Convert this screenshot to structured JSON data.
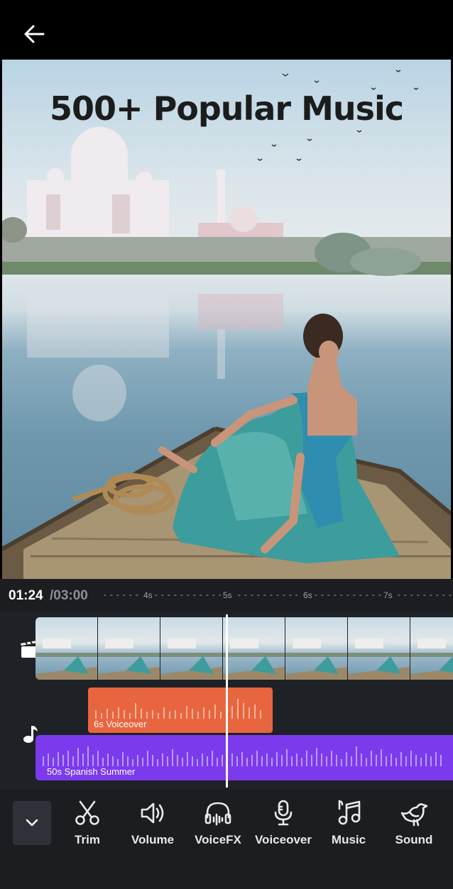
{
  "header": {
    "back_icon": "arrow-left-icon"
  },
  "preview": {
    "headline": "500+ Popular Music"
  },
  "timeline": {
    "current_time": "01:24",
    "total_time": "/03:00",
    "ruler_labels": [
      "4s",
      "5s",
      "6s",
      "7s"
    ]
  },
  "tracks": {
    "video_icon": "clapperboard-icon",
    "audio_icon": "music-note-icon",
    "voiceover_clip": {
      "label": "6s Voiceover",
      "color": "#e8663f"
    },
    "music_clip": {
      "label": "50s Spanish Summer",
      "color": "#7c3aed"
    }
  },
  "toolbar": {
    "collapse_icon": "chevron-down-icon",
    "tools": [
      {
        "label": "Trim",
        "icon": "scissors-icon"
      },
      {
        "label": "Volume",
        "icon": "speaker-icon"
      },
      {
        "label": "VoiceFX",
        "icon": "headphones-icon"
      },
      {
        "label": "Voiceover",
        "icon": "microphone-icon"
      },
      {
        "label": "Music",
        "icon": "music-notes-icon"
      },
      {
        "label": "Sound",
        "icon": "bird-icon"
      }
    ]
  }
}
